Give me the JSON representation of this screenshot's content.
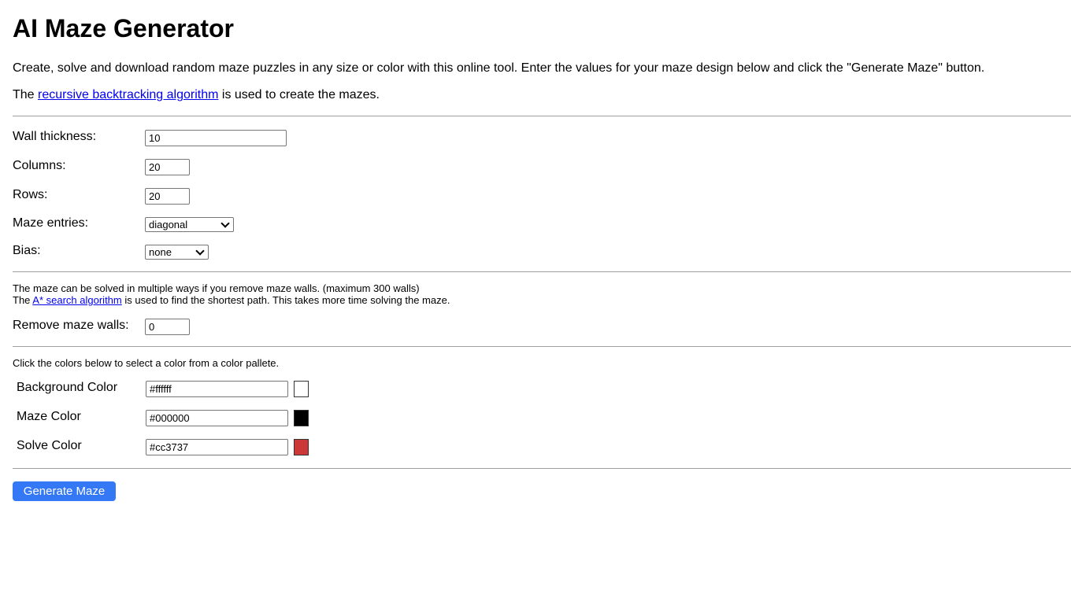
{
  "title": "AI Maze Generator",
  "intro": "Create, solve and download random maze puzzles in any size or color with this online tool. Enter the values for your maze design below and click the \"Generate Maze\" button.",
  "algo_line": {
    "prefix": "The ",
    "link": "recursive backtracking algorithm",
    "suffix": " is used to create the mazes."
  },
  "form": {
    "wall_thickness": {
      "label": "Wall thickness:",
      "value": "10"
    },
    "columns": {
      "label": "Columns:",
      "value": "20"
    },
    "rows": {
      "label": "Rows:",
      "value": "20"
    },
    "maze_entries": {
      "label": "Maze entries:",
      "value": "diagonal"
    },
    "bias": {
      "label": "Bias:",
      "value": "none"
    }
  },
  "solve_info": {
    "line1": "The maze can be solved in multiple ways if you remove maze walls. (maximum 300 walls)",
    "line2_prefix": "The ",
    "line2_link": "A* search algorithm",
    "line2_suffix": " is used to find the shortest path. This takes more time solving the maze."
  },
  "remove_walls": {
    "label": "Remove maze walls:",
    "value": "0"
  },
  "colors": {
    "hint": "Click the colors below to select a color from a color pallete.",
    "items": [
      {
        "label": "Background Color",
        "value": "#ffffff",
        "swatch": "#ffffff"
      },
      {
        "label": "Maze Color",
        "value": "#000000",
        "swatch": "#000000"
      },
      {
        "label": "Solve Color",
        "value": "#cc3737",
        "swatch": "#cc3737"
      }
    ]
  },
  "generate_button": "Generate Maze",
  "accent_color": "#3478f6"
}
